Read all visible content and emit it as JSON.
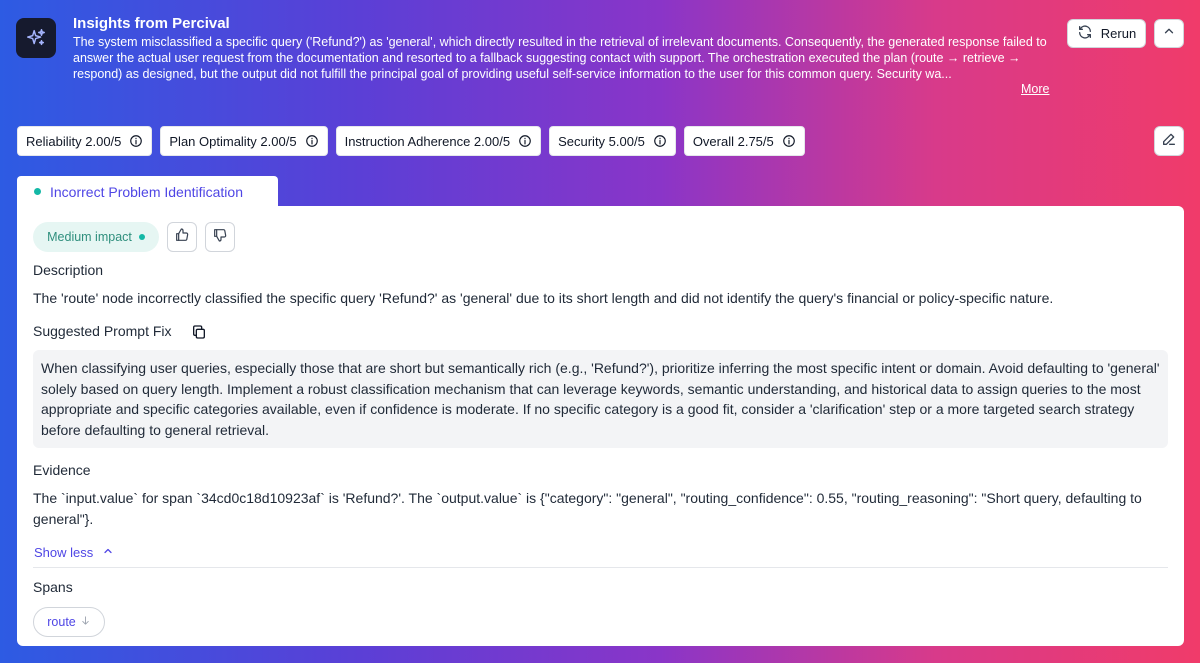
{
  "header": {
    "title": "Insights from Percival",
    "body": "The system misclassified a specific query ('Refund?') as 'general', which directly resulted in the retrieval of irrelevant documents. Consequently, the generated response failed to answer the actual user request from the documentation and resorted to a fallback suggesting contact with support. The orchestration executed the plan (route → retrieve → respond) as designed, but the output did not fulfill the principal goal of providing useful self-service information to the user for this common query. Security wa...",
    "more_label": "More",
    "rerun_label": "Rerun"
  },
  "scores": [
    {
      "label": "Reliability 2.00/5"
    },
    {
      "label": "Plan Optimality 2.00/5"
    },
    {
      "label": "Instruction Adherence 2.00/5"
    },
    {
      "label": "Security 5.00/5"
    },
    {
      "label": "Overall 2.75/5"
    }
  ],
  "tab": {
    "label": "Incorrect Problem Identification"
  },
  "card": {
    "impact_label": "Medium impact",
    "description_heading": "Description",
    "description_text": "The 'route' node incorrectly classified the specific query 'Refund?' as 'general' due to its short length and did not identify the query's financial or policy-specific nature.",
    "prompt_fix_heading": "Suggested Prompt Fix",
    "prompt_fix_text": "When classifying user queries, especially those that are short but semantically rich (e.g., 'Refund?'), prioritize inferring the most specific intent or domain. Avoid defaulting to 'general' solely based on query length. Implement a robust classification mechanism that can leverage keywords, semantic understanding, and historical data to assign queries to the most appropriate and specific categories available, even if confidence is moderate. If no specific category is a good fit, consider a 'clarification' step or a more targeted search strategy before defaulting to general retrieval.",
    "evidence_heading": "Evidence",
    "evidence_text": "The `input.value` for span `34cd0c18d10923af` is 'Refund?'. The `output.value` is {\"category\": \"general\", \"routing_confidence\": 0.55, \"routing_reasoning\": \"Short query, defaulting to general\"}.",
    "show_less_label": "Show less",
    "spans_heading": "Spans",
    "span_chip_label": "route"
  },
  "colors": {
    "accent": "#4f46e5",
    "impact_teal": "#14b8a6",
    "gradient_start": "#2d5be3",
    "gradient_end": "#f03b6a"
  }
}
